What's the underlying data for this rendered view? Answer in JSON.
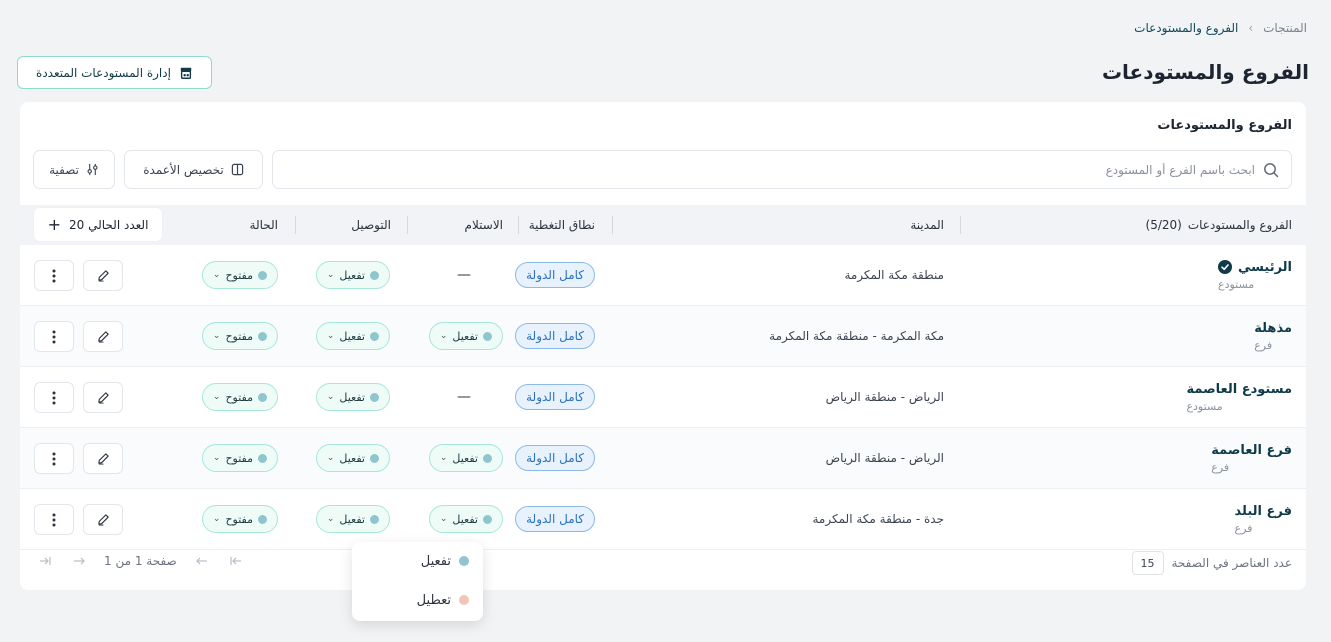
{
  "breadcrumb": {
    "root": "المنتجات",
    "separator": "›",
    "current": "الفروع والمستودعات"
  },
  "page": {
    "title": "الفروع والمستودعات",
    "manage_button": "إدارة المستودعات المتعددة"
  },
  "card": {
    "title": "الفروع والمستودعات",
    "search_placeholder": "ابحث باسم الفرع أو المستودع",
    "columns_button": "تخصيص الأعمدة",
    "filter_button": "تصفية"
  },
  "table": {
    "headers": {
      "name": "الفروع والمستودعات",
      "name_count": "(5/20)",
      "city": "المدينة",
      "coverage": "نطاق التغطية",
      "pickup": "الاستلام",
      "delivery": "التوصيل",
      "status": "الحالة",
      "current_count": "العدد الحالي 20"
    },
    "rows": [
      {
        "name": "الرئيسي",
        "type": "مستودع",
        "city": "منطقة مكة المكرمة",
        "coverage": "كامل الدولة",
        "pickup": "—",
        "delivery": "تفعيل",
        "status": "مفتوح",
        "is_main": true
      },
      {
        "name": "مذهلة",
        "type": "فرع",
        "city": "مكة المكرمة - منطقة مكة المكرمة",
        "coverage": "كامل الدولة",
        "pickup": "تفعيل",
        "delivery": "تفعيل",
        "status": "مفتوح",
        "is_main": false
      },
      {
        "name": "مستودع العاصمة",
        "type": "مستودع",
        "city": "الرياض - منطقة الرياض",
        "coverage": "كامل الدولة",
        "pickup": "—",
        "delivery": "تفعيل",
        "status": "مفتوح",
        "is_main": false
      },
      {
        "name": "فرع العاصمة",
        "type": "فرع",
        "city": "الرياض - منطقة الرياض",
        "coverage": "كامل الدولة",
        "pickup": "تفعيل",
        "delivery": "تفعيل",
        "status": "مفتوح",
        "is_main": false
      },
      {
        "name": "فرع البلد",
        "type": "فرع",
        "city": "جدة - منطقة مكة المكرمة",
        "coverage": "كامل الدولة",
        "pickup": "تفعيل",
        "delivery": "تفعيل",
        "status": "مفتوح",
        "is_main": false
      }
    ]
  },
  "pagination": {
    "label": "صفحة 1 من 1",
    "per_page_label": "عدد العناصر في الصفحة",
    "per_page_value": "15"
  },
  "dropdown": {
    "items": [
      {
        "label": "تفعيل",
        "color": "#8fc5cf"
      },
      {
        "label": "تعطيل",
        "color": "#f2c6b6"
      }
    ]
  },
  "colors": {
    "accent_border": "#8fdccb",
    "coverage_badge": "#2a6fc2",
    "pill_bg": "#effbf7",
    "title_text": "#0f3a4a"
  },
  "icons": {
    "breadcrumb_sep": "chevron-left-icon",
    "manage": "store-icon",
    "search": "search-icon",
    "columns": "columns-icon",
    "filter": "sliders-icon",
    "add": "plus-icon",
    "main": "check-circle-icon",
    "edit": "edit-icon",
    "more": "more-vertical-icon"
  }
}
